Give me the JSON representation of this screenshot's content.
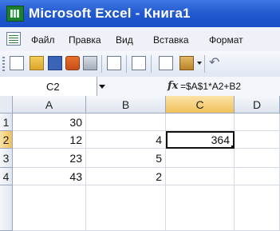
{
  "window": {
    "title": "Microsoft Excel - Книга1"
  },
  "menu": {
    "items": [
      "Файл",
      "Правка",
      "Вид",
      "Вставка",
      "Формат"
    ]
  },
  "toolbar": {
    "icons": [
      "new-icon",
      "open-icon",
      "save-icon",
      "permission-icon",
      "print-icon",
      "print-preview-icon",
      "spelling-icon",
      "copy-icon",
      "paste-icon",
      "undo-icon"
    ]
  },
  "formula_bar": {
    "name_box": "C2",
    "fx_label": "fx",
    "formula": "=$A$1*A2+B2"
  },
  "sheet": {
    "columns": [
      "A",
      "B",
      "C",
      "D"
    ],
    "rows": [
      {
        "label": "1",
        "cells": [
          "30",
          "",
          "",
          ""
        ]
      },
      {
        "label": "2",
        "cells": [
          "12",
          "4",
          "364",
          ""
        ]
      },
      {
        "label": "3",
        "cells": [
          "23",
          "5",
          "",
          ""
        ]
      },
      {
        "label": "4",
        "cells": [
          "43",
          "2",
          "",
          ""
        ]
      }
    ],
    "active_cell": "C2"
  },
  "colors": {
    "titlebar": "#2259cf",
    "active_header": "#f1c15a"
  }
}
